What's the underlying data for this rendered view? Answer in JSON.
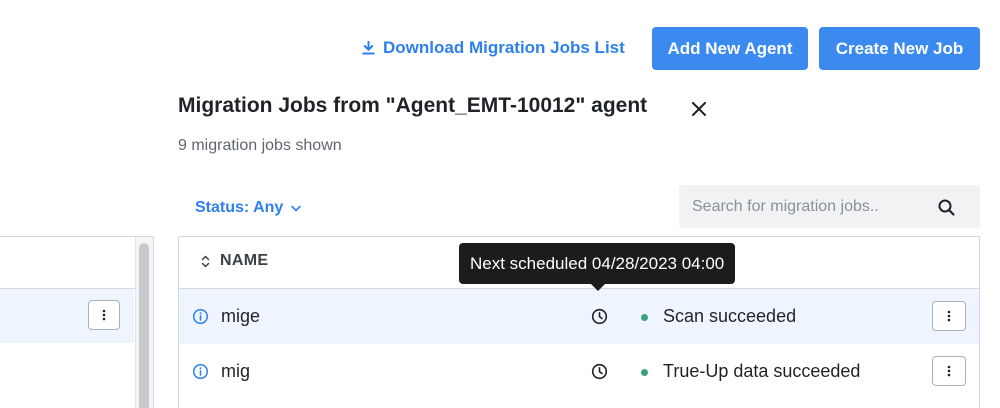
{
  "toolbar": {
    "download_label": "Download Migration Jobs List",
    "add_agent_label": "Add New Agent",
    "create_job_label": "Create New Job"
  },
  "header": {
    "title": "Migration Jobs from \"Agent_EMT-10012\" agent",
    "subtitle": "9 migration jobs shown"
  },
  "filters": {
    "status_label": "Status: Any"
  },
  "search": {
    "placeholder": "Search for migration jobs..",
    "value": ""
  },
  "table": {
    "columns": {
      "name": "NAME"
    },
    "rows": [
      {
        "name": "mige",
        "status": "Scan succeeded",
        "status_color": "#3aa17e",
        "hovered": true
      },
      {
        "name": "mig",
        "status": "True-Up data succeeded",
        "status_color": "#3aa17e",
        "hovered": false
      }
    ]
  },
  "tooltip": {
    "text": "Next scheduled 04/28/2023 04:00"
  },
  "icons": {
    "download": "download-icon",
    "close": "close-icon",
    "chevron": "chevron-down-icon",
    "search": "search-icon",
    "sort": "sort-icon",
    "info": "info-icon",
    "clock": "clock-icon",
    "more": "more-vertical-icon"
  },
  "colors": {
    "accent": "#2f80ed",
    "primary_button": "#3b8af0",
    "row_highlight": "#eef5ff",
    "tooltip_bg": "#1c1c1c"
  }
}
